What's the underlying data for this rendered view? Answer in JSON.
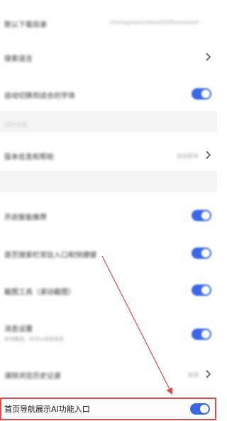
{
  "settings": {
    "rows": [
      {
        "label": "默认下载目录",
        "value": "/storage/emulated/0/Download/..."
      },
      {
        "label": "搜索语言"
      },
      {
        "label": "自动切换到适合的字体"
      },
      {
        "label": "您的设置"
      },
      {
        "label": "版本信息和帮助",
        "value": "当前版本"
      },
      {
        "label": "开启智能推荐"
      },
      {
        "label": "首页搜索栏常驻入口和快捷键"
      },
      {
        "label": "截图工具（滚动截图）"
      },
      {
        "label": "消息设置",
        "sub": "关闭推送，仍可以收到消息"
      },
      {
        "label": "清除浏览历史记录",
        "value": "清理"
      },
      {
        "label": "首页导航展示AI功能入口"
      }
    ]
  },
  "colors": {
    "toggle_on": "#3b67e6",
    "highlight": "#e14b47",
    "arrow": "#e14b47"
  },
  "icons": {
    "chevron": "chevron-right-icon"
  }
}
